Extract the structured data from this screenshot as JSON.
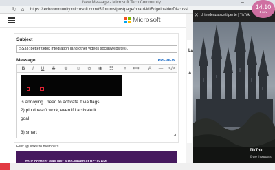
{
  "browser": {
    "tab_title": "New Message - Microsoft Tech Community",
    "url": "https://techcommunity.microsoft.com/t5/forums/postpage/board-id/EdgeInsiderDiscussions",
    "back_icon": "back-arrow-icon",
    "reload_icon": "reload-icon",
    "home_icon": "home-icon"
  },
  "header": {
    "brand": "Microsoft",
    "menu_icon": "hamburger-menu-icon"
  },
  "form": {
    "subject_label": "Subject",
    "subject_value": "SS33: better tiktok integration (and other videos social/websites).",
    "message_label": "Message",
    "preview_label": "PREVIEW",
    "toolbar": [
      "B",
      "I",
      "U",
      "S",
      "⊕",
      "☺",
      "⊘",
      "◉",
      "☷",
      "≡",
      "⟺",
      "A",
      "—",
      "</>"
    ],
    "body_lines": [
      "is annoying i need to activate it via flags",
      "2) pip doesn't work, even if i activate it",
      "goal",
      "",
      "3) smart"
    ],
    "hint_text": "Hint: @ links to members",
    "autosave_text": "Your content was last auto-saved at 02:05 AM"
  },
  "side": {
    "label_la": "La",
    "label_a": "A"
  },
  "video": {
    "title_text": "di tendenza scelti per te | TikTok",
    "close_icon": "close-icon",
    "tiktok_label": "TikTok",
    "username": "@the_hogwarts"
  },
  "clock": {
    "time": "14:10",
    "date": "1 nov"
  },
  "colors": {
    "accent": "#1c6cc7",
    "footer_purple": "#46195e",
    "clock_pink": "#cf6fa1"
  }
}
